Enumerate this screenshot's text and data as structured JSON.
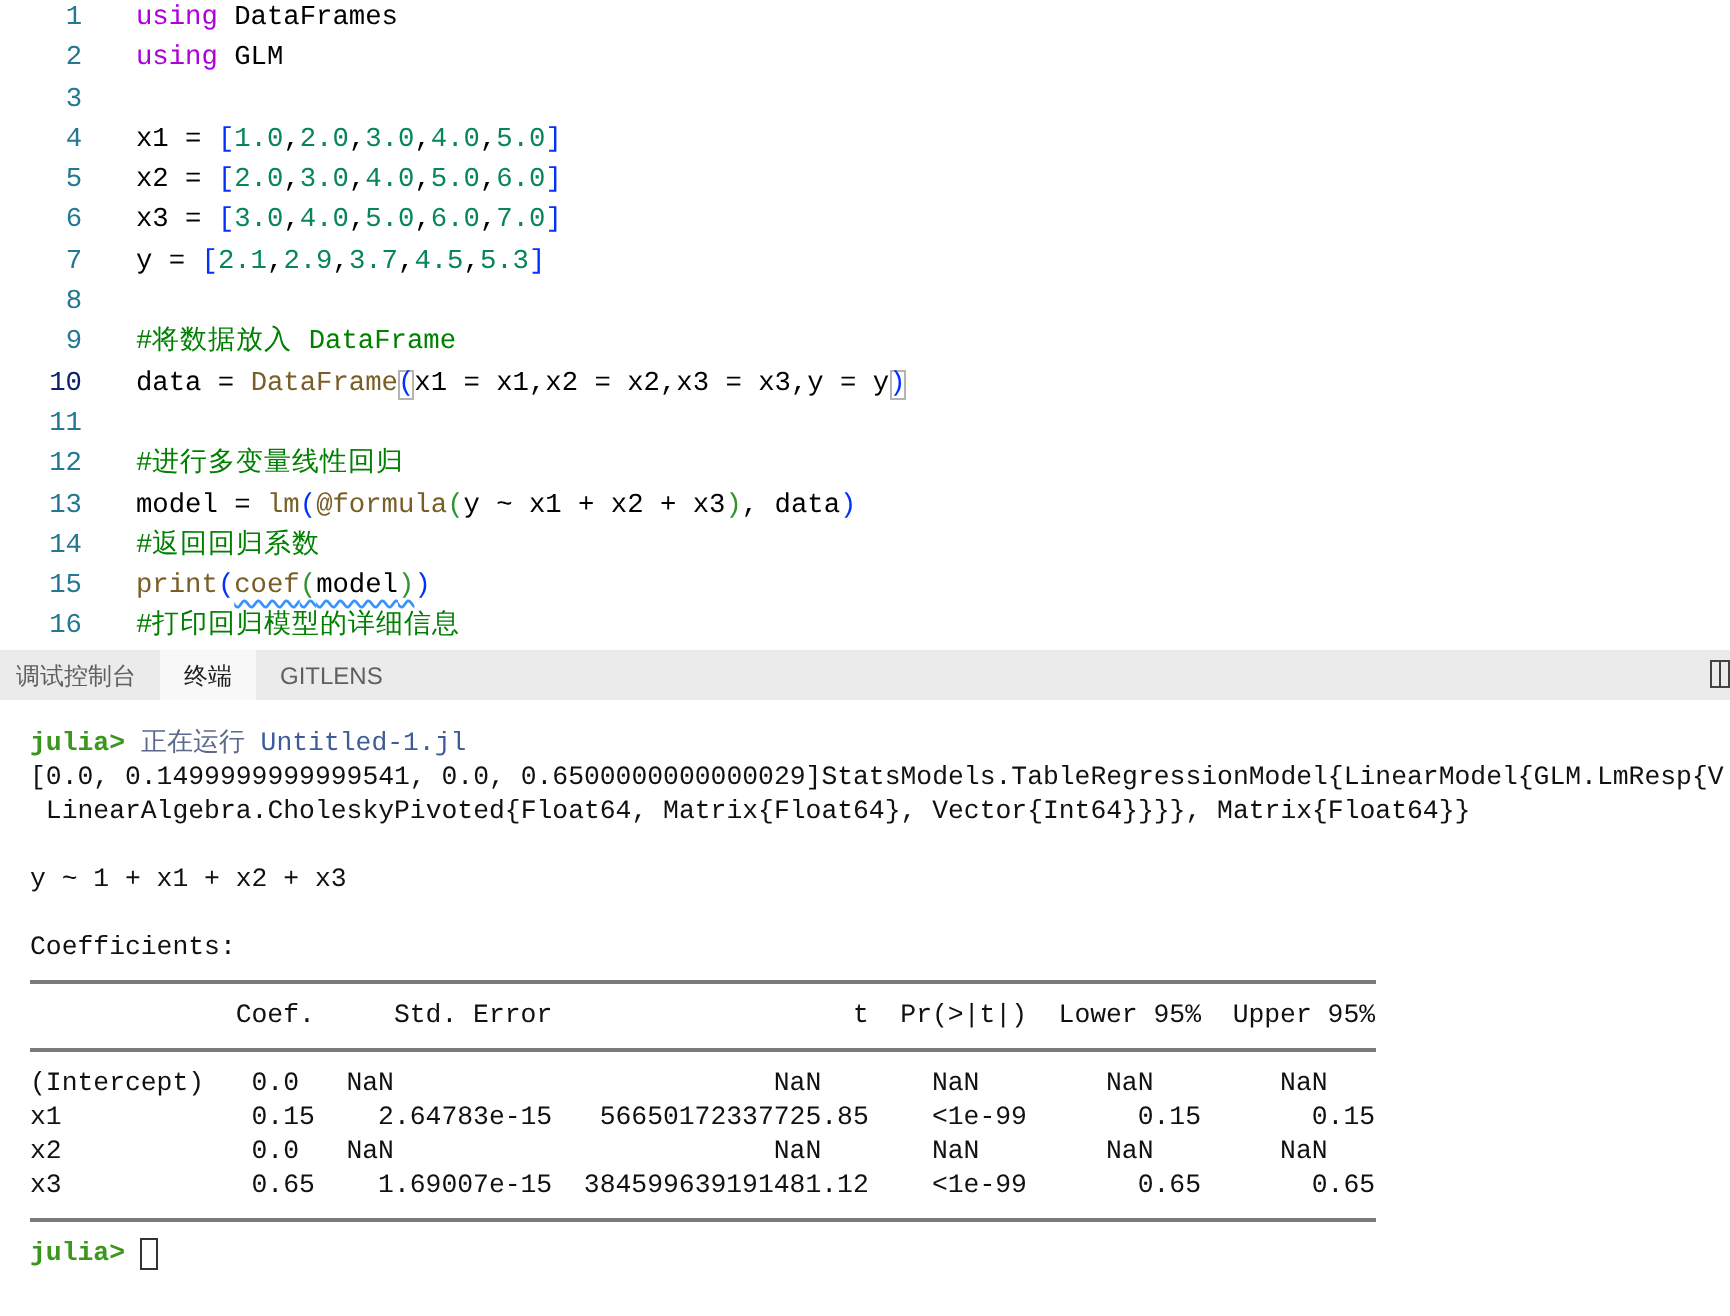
{
  "editor": {
    "lines": [
      {
        "number": "1",
        "current": false,
        "tokens": [
          {
            "kind": "keyword",
            "text": "using"
          },
          {
            "kind": "plain",
            "text": " DataFrames"
          }
        ]
      },
      {
        "number": "2",
        "current": false,
        "tokens": [
          {
            "kind": "keyword",
            "text": "using"
          },
          {
            "kind": "plain",
            "text": " GLM"
          }
        ]
      },
      {
        "number": "3",
        "current": false
      },
      {
        "number": "4",
        "current": false,
        "tokens": [
          {
            "kind": "plain",
            "text": "x1 = "
          },
          {
            "kind": "bracket",
            "text": "["
          },
          {
            "kind": "number",
            "text": "1.0"
          },
          {
            "kind": "plain",
            "text": ","
          },
          {
            "kind": "number",
            "text": "2.0"
          },
          {
            "kind": "plain",
            "text": ","
          },
          {
            "kind": "number",
            "text": "3.0"
          },
          {
            "kind": "plain",
            "text": ","
          },
          {
            "kind": "number",
            "text": "4.0"
          },
          {
            "kind": "plain",
            "text": ","
          },
          {
            "kind": "number",
            "text": "5.0"
          },
          {
            "kind": "bracket",
            "text": "]"
          }
        ]
      },
      {
        "number": "5",
        "current": false,
        "tokens": [
          {
            "kind": "plain",
            "text": "x2 = "
          },
          {
            "kind": "bracket",
            "text": "["
          },
          {
            "kind": "number",
            "text": "2.0"
          },
          {
            "kind": "plain",
            "text": ","
          },
          {
            "kind": "number",
            "text": "3.0"
          },
          {
            "kind": "plain",
            "text": ","
          },
          {
            "kind": "number",
            "text": "4.0"
          },
          {
            "kind": "plain",
            "text": ","
          },
          {
            "kind": "number",
            "text": "5.0"
          },
          {
            "kind": "plain",
            "text": ","
          },
          {
            "kind": "number",
            "text": "6.0"
          },
          {
            "kind": "bracket",
            "text": "]"
          }
        ]
      },
      {
        "number": "6",
        "current": false,
        "tokens": [
          {
            "kind": "plain",
            "text": "x3 = "
          },
          {
            "kind": "bracket",
            "text": "["
          },
          {
            "kind": "number",
            "text": "3.0"
          },
          {
            "kind": "plain",
            "text": ","
          },
          {
            "kind": "number",
            "text": "4.0"
          },
          {
            "kind": "plain",
            "text": ","
          },
          {
            "kind": "number",
            "text": "5.0"
          },
          {
            "kind": "plain",
            "text": ","
          },
          {
            "kind": "number",
            "text": "6.0"
          },
          {
            "kind": "plain",
            "text": ","
          },
          {
            "kind": "number",
            "text": "7.0"
          },
          {
            "kind": "bracket",
            "text": "]"
          }
        ]
      },
      {
        "number": "7",
        "current": false,
        "tokens": [
          {
            "kind": "plain",
            "text": "y = "
          },
          {
            "kind": "bracket",
            "text": "["
          },
          {
            "kind": "number",
            "text": "2.1"
          },
          {
            "kind": "plain",
            "text": ","
          },
          {
            "kind": "number",
            "text": "2.9"
          },
          {
            "kind": "plain",
            "text": ","
          },
          {
            "kind": "number",
            "text": "3.7"
          },
          {
            "kind": "plain",
            "text": ","
          },
          {
            "kind": "number",
            "text": "4.5"
          },
          {
            "kind": "plain",
            "text": ","
          },
          {
            "kind": "number",
            "text": "5.3"
          },
          {
            "kind": "bracket",
            "text": "]"
          }
        ]
      },
      {
        "number": "8",
        "current": false
      },
      {
        "number": "9",
        "current": false,
        "tokens": [
          {
            "kind": "comment",
            "text": "#将数据放入 DataFrame"
          }
        ]
      },
      {
        "number": "10",
        "current": true,
        "tokens": [
          {
            "kind": "plain",
            "text": "data = "
          },
          {
            "kind": "function",
            "text": "DataFrame"
          },
          {
            "kind": "matched",
            "text": "("
          },
          {
            "kind": "plain",
            "text": "x1 = x1,x2 = x2,x3 = x3,y = y"
          },
          {
            "kind": "matched",
            "text": ")"
          }
        ]
      },
      {
        "number": "11",
        "current": false
      },
      {
        "number": "12",
        "current": false,
        "tokens": [
          {
            "kind": "comment",
            "text": "#进行多变量线性回归"
          }
        ]
      },
      {
        "number": "13",
        "current": false,
        "tokens": [
          {
            "kind": "plain",
            "text": "model = "
          },
          {
            "kind": "function",
            "text": "lm"
          },
          {
            "kind": "bracket",
            "text": "("
          },
          {
            "kind": "function",
            "text": "@formula"
          },
          {
            "kind": "nested",
            "text": "("
          },
          {
            "kind": "plain",
            "text": "y ~ x1 + x2 + x3"
          },
          {
            "kind": "nested",
            "text": ")"
          },
          {
            "kind": "plain",
            "text": ", data"
          },
          {
            "kind": "bracket",
            "text": ")"
          }
        ]
      },
      {
        "number": "14",
        "current": false,
        "tokens": [
          {
            "kind": "comment",
            "text": "#返回回归系数"
          }
        ]
      },
      {
        "number": "15",
        "current": false,
        "tokens": [
          {
            "kind": "function",
            "text": "print",
            "underlined": false
          },
          {
            "kind": "bracket",
            "text": "(",
            "underlined": false
          },
          {
            "kind": "function",
            "text": "coef",
            "underlined": true
          },
          {
            "kind": "nested",
            "text": "(",
            "underlined": true
          },
          {
            "kind": "plain",
            "text": "model",
            "underlined": true
          },
          {
            "kind": "nested",
            "text": ")",
            "underlined": true
          },
          {
            "kind": "bracket",
            "text": ")",
            "underlined": false
          }
        ]
      },
      {
        "number": "16",
        "current": false,
        "tokens": [
          {
            "kind": "comment",
            "text": "#打印回归模型的详细信息"
          }
        ]
      }
    ]
  },
  "panel": {
    "tabs": [
      {
        "label": "调试控制台",
        "selected": false
      },
      {
        "label": "终端",
        "selected": true
      },
      {
        "label": "GITLENS",
        "selected": false
      }
    ]
  },
  "terminal": {
    "run_line": {
      "prompt": "julia>",
      "status": "正在运行",
      "file": "Untitled-1.jl"
    },
    "output": [
      "[0.0, 0.1499999999999541, 0.0, 0.6500000000000029]StatsModels.TableRegressionModel{LinearModel{GLM.LmResp{V",
      " LinearAlgebra.CholeskyPivoted{Float64, Matrix{Float64}, Vector{Int64}}}}, Matrix{Float64}}"
    ],
    "formula": "y ~ 1 + x1 + x2 + x3",
    "coefficients_title": "Coefficients:",
    "table": {
      "columns": [
        "Coef.",
        "Std. Error",
        "t",
        "Pr(>|t|)",
        "Lower 95%",
        "Upper 95%"
      ],
      "rows": [
        {
          "label": "(Intercept)",
          "cells": [
            "0.0",
            "NaN",
            "NaN",
            "NaN",
            "NaN",
            "NaN"
          ]
        },
        {
          "label": "x1",
          "cells": [
            "0.15",
            "2.64783e-15",
            "56650172337725.85",
            "<1e-99",
            "0.15",
            "0.15"
          ]
        },
        {
          "label": "x2",
          "cells": [
            "0.0",
            "NaN",
            "NaN",
            "NaN",
            "NaN",
            "NaN"
          ]
        },
        {
          "label": "x3",
          "cells": [
            "0.65",
            "1.69007e-15",
            "384599639191481.12",
            "<1e-99",
            "0.65",
            "0.65"
          ]
        }
      ]
    },
    "prompt": "julia>"
  }
}
